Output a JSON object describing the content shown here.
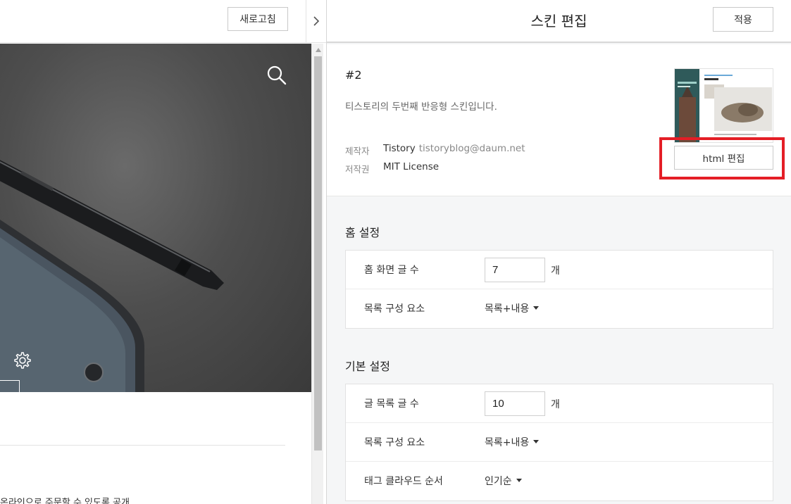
{
  "left": {
    "refresh_label": "새로고침",
    "preview_text": "온라인으로 주문할 수 있도록 공개"
  },
  "right": {
    "title": "스킨 편집",
    "apply_label": "적용",
    "skin": {
      "name": "#2",
      "description": "티스토리의 두번째 반응형 스킨입니다.",
      "author_label": "제작자",
      "author_name": "Tistory",
      "author_email": "tistoryblog@daum.net",
      "license_label": "저작권",
      "license_value": "MIT License",
      "html_edit_label": "html 편집"
    },
    "home_settings": {
      "title": "홈 설정",
      "rows": [
        {
          "label": "홈 화면 글 수",
          "value": "7",
          "unit": "개"
        },
        {
          "label": "목록 구성 요소",
          "value": "목록+내용"
        }
      ]
    },
    "basic_settings": {
      "title": "기본 설정",
      "rows": [
        {
          "label": "글 목록 글 수",
          "value": "10",
          "unit": "개"
        },
        {
          "label": "목록 구성 요소",
          "value": "목록+내용"
        },
        {
          "label": "태그 클라우드 순서",
          "value": "인기순"
        }
      ]
    }
  },
  "colors": {
    "highlight": "#e41e26",
    "panel_bg": "#f5f6f7",
    "border": "#c9c9c9"
  },
  "icons": [
    "chevron-right-icon",
    "search-icon",
    "gear-icon",
    "scroll-up-arrow-icon",
    "caret-down-icon"
  ]
}
